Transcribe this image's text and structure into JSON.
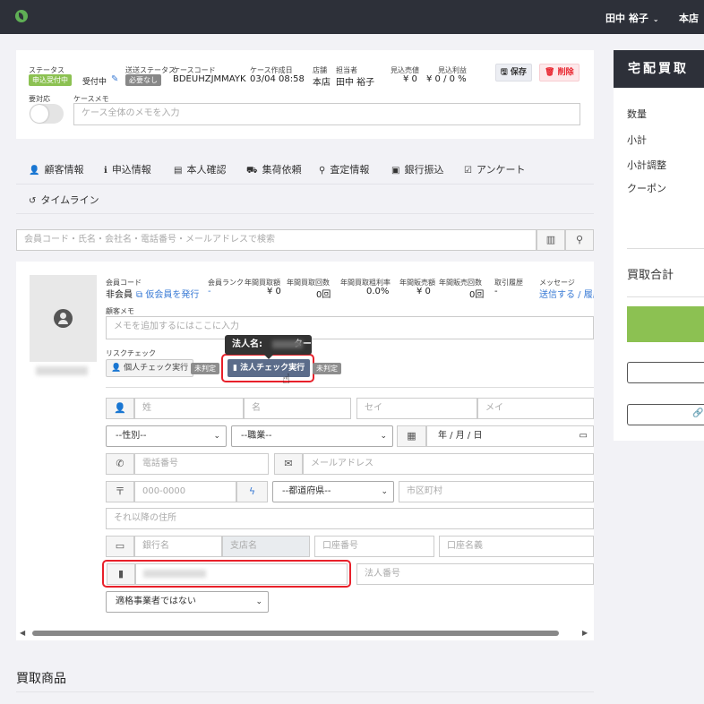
{
  "topbar": {
    "user": "田中 裕子",
    "store": "本店"
  },
  "case": {
    "status_label": "ステータス",
    "status_badge": "申込受付中",
    "status_value": "受付中",
    "shipping_label": "送送ステータス",
    "shipping_badge": "必要なし",
    "code_label": "ケースコード",
    "code_value": "BDEUHZJMMAYK",
    "created_label": "ケース作成日",
    "created_value": "03/04 08:58",
    "store_label": "店舗",
    "store_value": "本店",
    "owner_label": "担当者",
    "owner_value": "田中 裕子",
    "est_sales_label": "見込売値",
    "est_sales_value": "¥ 0",
    "est_profit_label": "見込利益",
    "est_profit_value": "¥ 0 / 0 %",
    "save_label": "保存",
    "delete_label": "削除",
    "attention_label": "要対応",
    "memo_label": "ケースメモ",
    "memo_placeholder": "ケース全体のメモを入力"
  },
  "tabs": [
    {
      "icon": "user-icon",
      "label": "顧客情報"
    },
    {
      "icon": "info-icon",
      "label": "申込情報"
    },
    {
      "icon": "id-card-icon",
      "label": "本人確認"
    },
    {
      "icon": "truck-icon",
      "label": "集荷依頼"
    },
    {
      "icon": "search-icon",
      "label": "査定情報"
    },
    {
      "icon": "money-icon",
      "label": "銀行振込"
    },
    {
      "icon": "check-square-icon",
      "label": "アンケート"
    },
    {
      "icon": "history-icon",
      "label": "タイムライン"
    }
  ],
  "search": {
    "placeholder": "会員コード・氏名・会社名・電話番号・メールアドレスで検索"
  },
  "customer": {
    "member_code_label": "会員コード",
    "member_code_value": "非会員",
    "issue_link": "仮会員を発行",
    "rank_label": "会員ランク",
    "rank_value": "-",
    "annual_amount_label": "年間買取額",
    "annual_amount_value": "¥ 0",
    "annual_count_label": "年間買取回数",
    "annual_count_value": "0回",
    "gross_margin_label": "年間買取粗利率",
    "gross_margin_value": "0.0%",
    "sales_amount_label": "年間販売額",
    "sales_amount_value": "¥ 0",
    "sales_count_label": "年間販売回数",
    "sales_count_value": "0回",
    "history_label": "取引履歴",
    "history_value": "-",
    "message_label": "メッセージ",
    "message_value": "送信する / 履歴",
    "memo_label": "顧客メモ",
    "memo_placeholder": "メモを追加するにはここに入力",
    "risk_label": "リスクチェック",
    "personal_check": "個人チェック実行",
    "undetermined": "未判定",
    "corp_check": "法人チェック実行",
    "tooltip": "法人名:          ター"
  },
  "form": {
    "last_name": "姓",
    "first_name": "名",
    "last_kana": "セイ",
    "first_kana": "メイ",
    "gender": "--性別--",
    "occupation": "--職業--",
    "date": "年 / 月 / 日",
    "phone": "電話番号",
    "email": "メールアドレス",
    "zip": "000-0000",
    "prefecture": "--都道府県--",
    "city": "市区町村",
    "address": "それ以降の住所",
    "bank": "銀行名",
    "branch": "支店名",
    "account_no": "口座番号",
    "account_name": "口座名義",
    "corp_number": "法人番号",
    "invoice": "適格事業者ではない"
  },
  "section_title": "買取商品",
  "right_panel": {
    "title": "宅配買取",
    "rows": [
      "数量",
      "小計",
      "小計調整",
      "クーポン"
    ],
    "total_label": "買取合計"
  },
  "colors": {
    "accent": "#3a7bd5",
    "success": "#8cc152",
    "danger": "#e8202a",
    "topbar": "#2d3039"
  }
}
